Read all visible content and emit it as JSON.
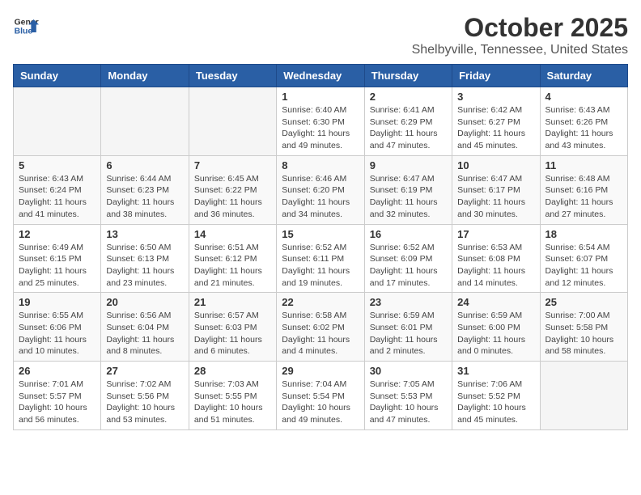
{
  "header": {
    "logo_line1": "General",
    "logo_line2": "Blue",
    "month_title": "October 2025",
    "location": "Shelbyville, Tennessee, United States"
  },
  "weekdays": [
    "Sunday",
    "Monday",
    "Tuesday",
    "Wednesday",
    "Thursday",
    "Friday",
    "Saturday"
  ],
  "weeks": [
    [
      {
        "day": "",
        "info": ""
      },
      {
        "day": "",
        "info": ""
      },
      {
        "day": "",
        "info": ""
      },
      {
        "day": "1",
        "info": "Sunrise: 6:40 AM\nSunset: 6:30 PM\nDaylight: 11 hours\nand 49 minutes."
      },
      {
        "day": "2",
        "info": "Sunrise: 6:41 AM\nSunset: 6:29 PM\nDaylight: 11 hours\nand 47 minutes."
      },
      {
        "day": "3",
        "info": "Sunrise: 6:42 AM\nSunset: 6:27 PM\nDaylight: 11 hours\nand 45 minutes."
      },
      {
        "day": "4",
        "info": "Sunrise: 6:43 AM\nSunset: 6:26 PM\nDaylight: 11 hours\nand 43 minutes."
      }
    ],
    [
      {
        "day": "5",
        "info": "Sunrise: 6:43 AM\nSunset: 6:24 PM\nDaylight: 11 hours\nand 41 minutes."
      },
      {
        "day": "6",
        "info": "Sunrise: 6:44 AM\nSunset: 6:23 PM\nDaylight: 11 hours\nand 38 minutes."
      },
      {
        "day": "7",
        "info": "Sunrise: 6:45 AM\nSunset: 6:22 PM\nDaylight: 11 hours\nand 36 minutes."
      },
      {
        "day": "8",
        "info": "Sunrise: 6:46 AM\nSunset: 6:20 PM\nDaylight: 11 hours\nand 34 minutes."
      },
      {
        "day": "9",
        "info": "Sunrise: 6:47 AM\nSunset: 6:19 PM\nDaylight: 11 hours\nand 32 minutes."
      },
      {
        "day": "10",
        "info": "Sunrise: 6:47 AM\nSunset: 6:17 PM\nDaylight: 11 hours\nand 30 minutes."
      },
      {
        "day": "11",
        "info": "Sunrise: 6:48 AM\nSunset: 6:16 PM\nDaylight: 11 hours\nand 27 minutes."
      }
    ],
    [
      {
        "day": "12",
        "info": "Sunrise: 6:49 AM\nSunset: 6:15 PM\nDaylight: 11 hours\nand 25 minutes."
      },
      {
        "day": "13",
        "info": "Sunrise: 6:50 AM\nSunset: 6:13 PM\nDaylight: 11 hours\nand 23 minutes."
      },
      {
        "day": "14",
        "info": "Sunrise: 6:51 AM\nSunset: 6:12 PM\nDaylight: 11 hours\nand 21 minutes."
      },
      {
        "day": "15",
        "info": "Sunrise: 6:52 AM\nSunset: 6:11 PM\nDaylight: 11 hours\nand 19 minutes."
      },
      {
        "day": "16",
        "info": "Sunrise: 6:52 AM\nSunset: 6:09 PM\nDaylight: 11 hours\nand 17 minutes."
      },
      {
        "day": "17",
        "info": "Sunrise: 6:53 AM\nSunset: 6:08 PM\nDaylight: 11 hours\nand 14 minutes."
      },
      {
        "day": "18",
        "info": "Sunrise: 6:54 AM\nSunset: 6:07 PM\nDaylight: 11 hours\nand 12 minutes."
      }
    ],
    [
      {
        "day": "19",
        "info": "Sunrise: 6:55 AM\nSunset: 6:06 PM\nDaylight: 11 hours\nand 10 minutes."
      },
      {
        "day": "20",
        "info": "Sunrise: 6:56 AM\nSunset: 6:04 PM\nDaylight: 11 hours\nand 8 minutes."
      },
      {
        "day": "21",
        "info": "Sunrise: 6:57 AM\nSunset: 6:03 PM\nDaylight: 11 hours\nand 6 minutes."
      },
      {
        "day": "22",
        "info": "Sunrise: 6:58 AM\nSunset: 6:02 PM\nDaylight: 11 hours\nand 4 minutes."
      },
      {
        "day": "23",
        "info": "Sunrise: 6:59 AM\nSunset: 6:01 PM\nDaylight: 11 hours\nand 2 minutes."
      },
      {
        "day": "24",
        "info": "Sunrise: 6:59 AM\nSunset: 6:00 PM\nDaylight: 11 hours\nand 0 minutes."
      },
      {
        "day": "25",
        "info": "Sunrise: 7:00 AM\nSunset: 5:58 PM\nDaylight: 10 hours\nand 58 minutes."
      }
    ],
    [
      {
        "day": "26",
        "info": "Sunrise: 7:01 AM\nSunset: 5:57 PM\nDaylight: 10 hours\nand 56 minutes."
      },
      {
        "day": "27",
        "info": "Sunrise: 7:02 AM\nSunset: 5:56 PM\nDaylight: 10 hours\nand 53 minutes."
      },
      {
        "day": "28",
        "info": "Sunrise: 7:03 AM\nSunset: 5:55 PM\nDaylight: 10 hours\nand 51 minutes."
      },
      {
        "day": "29",
        "info": "Sunrise: 7:04 AM\nSunset: 5:54 PM\nDaylight: 10 hours\nand 49 minutes."
      },
      {
        "day": "30",
        "info": "Sunrise: 7:05 AM\nSunset: 5:53 PM\nDaylight: 10 hours\nand 47 minutes."
      },
      {
        "day": "31",
        "info": "Sunrise: 7:06 AM\nSunset: 5:52 PM\nDaylight: 10 hours\nand 45 minutes."
      },
      {
        "day": "",
        "info": ""
      }
    ]
  ]
}
